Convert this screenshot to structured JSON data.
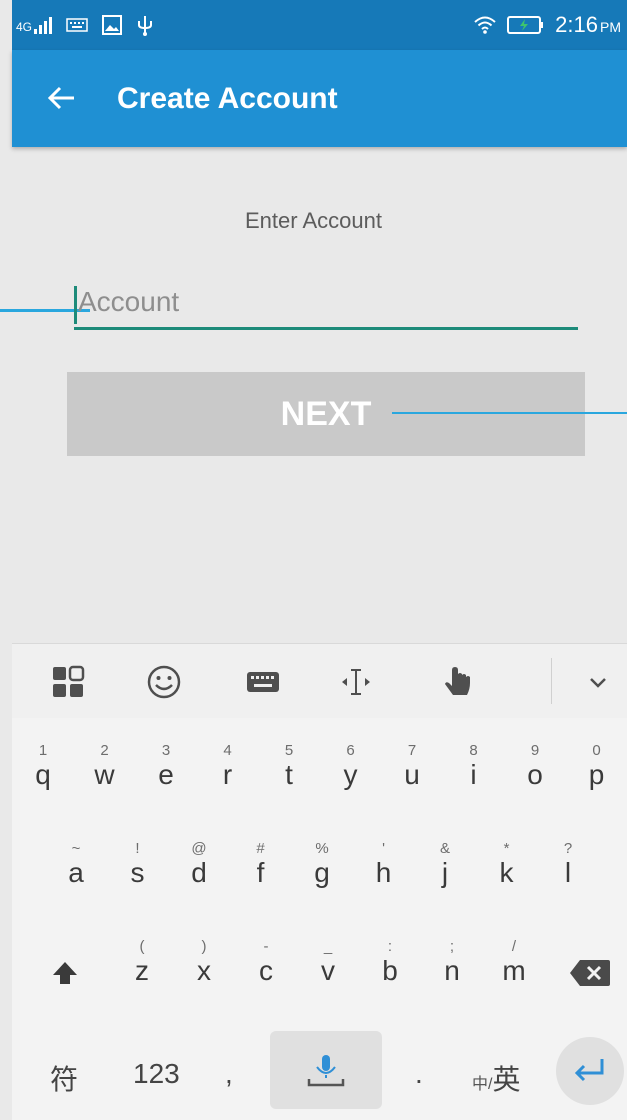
{
  "status_bar": {
    "network": "4G",
    "time": "2:16",
    "ampm": "PM"
  },
  "app_bar": {
    "title": "Create Account"
  },
  "form": {
    "prompt": "Enter Account",
    "account_placeholder": "Account",
    "account_value": "",
    "next_label": "NEXT"
  },
  "keyboard": {
    "toolbar_icons": [
      "apps-grid-icon",
      "emoji-icon",
      "keyboard-icon",
      "cursor-move-icon",
      "gesture-hand-icon",
      "collapse-chevron-icon"
    ],
    "row1": [
      {
        "hint": "1",
        "key": "q"
      },
      {
        "hint": "2",
        "key": "w"
      },
      {
        "hint": "3",
        "key": "e"
      },
      {
        "hint": "4",
        "key": "r"
      },
      {
        "hint": "5",
        "key": "t"
      },
      {
        "hint": "6",
        "key": "y"
      },
      {
        "hint": "7",
        "key": "u"
      },
      {
        "hint": "8",
        "key": "i"
      },
      {
        "hint": "9",
        "key": "o"
      },
      {
        "hint": "0",
        "key": "p"
      }
    ],
    "row2": [
      {
        "hint": "~",
        "key": "a"
      },
      {
        "hint": "!",
        "key": "s"
      },
      {
        "hint": "@",
        "key": "d"
      },
      {
        "hint": "#",
        "key": "f"
      },
      {
        "hint": "%",
        "key": "g"
      },
      {
        "hint": "'",
        "key": "h"
      },
      {
        "hint": "&",
        "key": "j"
      },
      {
        "hint": "*",
        "key": "k"
      },
      {
        "hint": "?",
        "key": "l"
      }
    ],
    "row3": [
      {
        "hint": "(",
        "key": "z"
      },
      {
        "hint": ")",
        "key": "x"
      },
      {
        "hint": "-",
        "key": "c"
      },
      {
        "hint": "_",
        "key": "v"
      },
      {
        "hint": ":",
        "key": "b"
      },
      {
        "hint": ";",
        "key": "n"
      },
      {
        "hint": "/",
        "key": "m"
      }
    ],
    "symbols_label": "符",
    "numbers_label": "123",
    "comma_label": ",",
    "period_label": ".",
    "lang_small": "中/",
    "lang_label": "英"
  },
  "colors": {
    "status_bar": "#1679b8",
    "app_bar": "#1f90d3",
    "field_underline": "#1d8b7a",
    "button_disabled": "#c9c9c9",
    "enter_arrow": "#2f8fd6"
  }
}
